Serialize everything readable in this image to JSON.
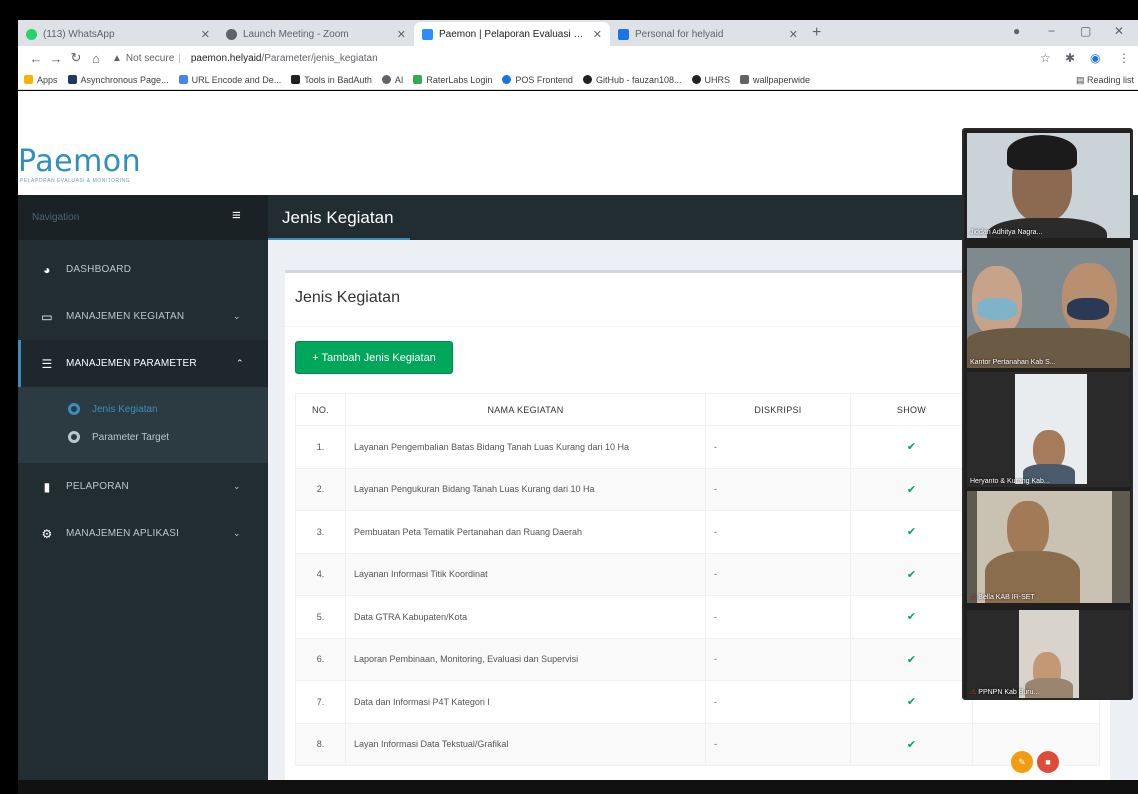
{
  "browser": {
    "tabs": [
      {
        "title": "(113) WhatsApp",
        "fav_color": "#25d366",
        "active": false
      },
      {
        "title": "Launch Meeting - Zoom",
        "fav_color": "#5f6368",
        "active": false
      },
      {
        "title": "Paemon | Pelaporan Evaluasi & M",
        "fav_color": "#2d8cff",
        "active": true
      },
      {
        "title": "Personal for helyaid",
        "fav_color": "#1a73e8",
        "active": false
      }
    ],
    "security": "Not secure",
    "host": "paemon.helyaid",
    "path": "/Parameter/jenis_kegiatan",
    "bookmarks": [
      {
        "label": "Apps",
        "color": "#f4b400"
      },
      {
        "label": "Asynchronous Page...",
        "color": "#1e3a5f"
      },
      {
        "label": "URL Encode and De...",
        "color": "#4285f4"
      },
      {
        "label": "Tools in BadAuth",
        "color": "#202124"
      },
      {
        "label": "AI",
        "color": "#5f6368"
      },
      {
        "label": "RaterLabs Login",
        "color": "#34a853"
      },
      {
        "label": "POS Frontend",
        "color": "#1a73e8"
      },
      {
        "label": "GitHub - fauzan108...",
        "color": "#202124"
      },
      {
        "label": "UHRS",
        "color": "#202124"
      },
      {
        "label": "wallpaperwide",
        "color": "#5f6368"
      }
    ],
    "reading_list": "Reading list"
  },
  "app": {
    "logo": "Paemon",
    "tagline": "PELAPORAN EVALUASI & MONITORING",
    "navigation_label": "Navigation",
    "page_title": "Jenis Kegiatan",
    "sidebar": [
      {
        "label": "DASHBOARD",
        "icon": "dashboard-icon",
        "glyph": "◕",
        "caret": ""
      },
      {
        "label": "MANAJEMEN KEGIATAN",
        "icon": "calendar-icon",
        "glyph": "▭",
        "caret": "⌄"
      },
      {
        "label": "MANAJEMEN PARAMETER",
        "icon": "list-icon",
        "glyph": "☰",
        "caret": "⌃"
      },
      {
        "label": "PELAPORAN",
        "icon": "chart-icon",
        "glyph": "▮",
        "caret": "⌄"
      },
      {
        "label": "MANAJEMEN APLIKASI",
        "icon": "gears-icon",
        "glyph": "⚙",
        "caret": "⌄"
      }
    ],
    "submenu": [
      {
        "label": "Jenis Kegiatan",
        "active": true
      },
      {
        "label": "Parameter Target",
        "active": false
      }
    ],
    "box_title": "Jenis Kegiatan",
    "add_button": "+ Tambah Jenis Kegiatan",
    "table": {
      "headers": [
        "NO.",
        "NAMA KEGIATAN",
        "DISKRIPSI",
        "SHOW",
        ""
      ],
      "rows": [
        {
          "no": "1.",
          "nama": "Layanan Pengembalian Batas Bidang Tanah Luas Kurang dari 10 Ha",
          "diskripsi": "-",
          "show": "✔"
        },
        {
          "no": "2.",
          "nama": "Layanan Pengukuran Bidang Tanah Luas Kurang dari 10 Ha",
          "diskripsi": "-",
          "show": "✔"
        },
        {
          "no": "3.",
          "nama": "Pembuatan Peta Tematik Pertanahan dan Ruang Daerah",
          "diskripsi": "-",
          "show": "✔"
        },
        {
          "no": "4.",
          "nama": "Layanan Informasi Titik Koordinat",
          "diskripsi": "-",
          "show": "✔"
        },
        {
          "no": "5.",
          "nama": "Data GTRA Kabupaten/Kota",
          "diskripsi": "-",
          "show": "✔"
        },
        {
          "no": "6.",
          "nama": "Laporan Pembinaan, Monitoring, Evaluasi dan Supervisi",
          "diskripsi": "-",
          "show": "✔"
        },
        {
          "no": "7.",
          "nama": "Data dan Informasi P4T Kategori I",
          "diskripsi": "-",
          "show": "✔"
        },
        {
          "no": "8.",
          "nama": "Layan Informasi Data Tekstual/Grafikal",
          "diskripsi": "-",
          "show": "✔"
        }
      ]
    }
  },
  "video": {
    "participants": [
      {
        "name": "Jiddan Adhitya Nagra...",
        "muted": false
      },
      {
        "name": "Kantor Pertanahan Kab S...",
        "muted": false
      },
      {
        "name": "Heryanto & Kurang Kab...",
        "muted": false
      },
      {
        "name": "Bella KAB IR-SET",
        "muted": true
      },
      {
        "name": "PPNPN Kab Buru...",
        "muted": true
      }
    ]
  }
}
